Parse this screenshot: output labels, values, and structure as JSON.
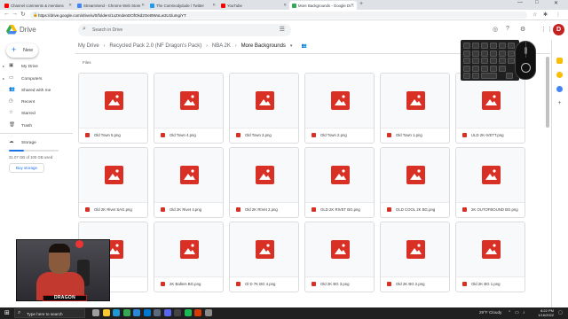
{
  "browser": {
    "tabs": [
      {
        "label": "Channel comments & mentions",
        "favicon_color": "#ff0000",
        "active": false
      },
      {
        "label": "StreamSend - Chrome Web Store",
        "favicon_color": "#4285f4",
        "active": false
      },
      {
        "label": "The Commodydude / Twitter",
        "favicon_color": "#1d9bf0",
        "active": false
      },
      {
        "label": "YouTube",
        "favicon_color": "#ff0000",
        "active": false
      },
      {
        "label": "More Backgrounds - Google Dr...",
        "favicon_color": "#34a853",
        "active": true
      }
    ],
    "new_tab_glyph": "+",
    "window_controls": [
      "—",
      "□",
      "✕"
    ],
    "nav": {
      "back": "←",
      "forward": "→",
      "reload": "↻"
    },
    "url": "https://drive.google.com/drive/u/0/folders/1xZmdenDOfOkd2Oet9WoLw3U1lumgiYT"
  },
  "drive": {
    "app_title": "Drive",
    "search_placeholder": "Search in Drive",
    "header_icons": [
      "help-icon",
      "settings-icon",
      "apps-icon"
    ],
    "avatar_letter": "D",
    "new_button_label": "New",
    "sidebar": [
      {
        "label": "My Drive",
        "icon": "▣",
        "caret": "▸"
      },
      {
        "label": "Computers",
        "icon": "▭",
        "caret": "▸"
      },
      {
        "label": "Shared with me",
        "icon": "👥",
        "caret": ""
      },
      {
        "label": "Recent",
        "icon": "◷",
        "caret": ""
      },
      {
        "label": "Starred",
        "icon": "☆",
        "caret": ""
      },
      {
        "label": "Trash",
        "icon": "🗑",
        "caret": ""
      }
    ],
    "storage": {
      "label": "Storage",
      "used_text": "31.07 GB of 100 GB used",
      "used_fraction": 0.31,
      "buy_label": "Buy storage"
    },
    "breadcrumb": [
      "My Drive",
      "Recycled Pack 2.0 (NF Dragon's Pack)",
      "NBA 2K",
      "More Backgrounds"
    ],
    "section_label": "Files",
    "files": [
      "Old Town 5.png",
      "Old Town 4.png",
      "Old Town 3.png",
      "Old Town 2.png",
      "Old Town 1.png",
      "ULD 2K-IVETT.png",
      "Old 2K Rivet SAG.png",
      "Old 2K Rivet 4.png",
      "Old 2K RIVet 2.png",
      "OLD 2K RIVET BG.png",
      "OLD COOL 2K BG.png",
      "2K OUTOFBOUND BG.png",
      "...png",
      "2K Ballers BG.png",
      "Ol D 7K BG 4.png",
      "Old 2K BG 3.png",
      "Old 2K BG 2.png",
      "Old 2K BG 1.png"
    ]
  },
  "webcam": {
    "banner_text": "DRAGON"
  },
  "taskbar": {
    "search_placeholder": "Type here to search",
    "weather": "29°F Cloudy",
    "time": "8:22 PM",
    "date": "1/16/2022",
    "apps": [
      {
        "name": "task-view-icon",
        "color": "#9e9e9e"
      },
      {
        "name": "file-explorer-icon",
        "color": "#f9c934"
      },
      {
        "name": "edge-icon",
        "color": "#1d9ad6"
      },
      {
        "name": "chrome-icon",
        "color": "#34a853"
      },
      {
        "name": "store-icon",
        "color": "#2b88d8"
      },
      {
        "name": "mail-icon",
        "color": "#0078d4"
      },
      {
        "name": "steam-icon",
        "color": "#5a6b7d"
      },
      {
        "name": "discord-icon",
        "color": "#5865f2"
      },
      {
        "name": "obs-icon",
        "color": "#444444"
      },
      {
        "name": "spotify-icon",
        "color": "#1db954"
      },
      {
        "name": "photos-icon",
        "color": "#d83b01"
      },
      {
        "name": "settings-icon",
        "color": "#8a8a8a"
      }
    ]
  }
}
